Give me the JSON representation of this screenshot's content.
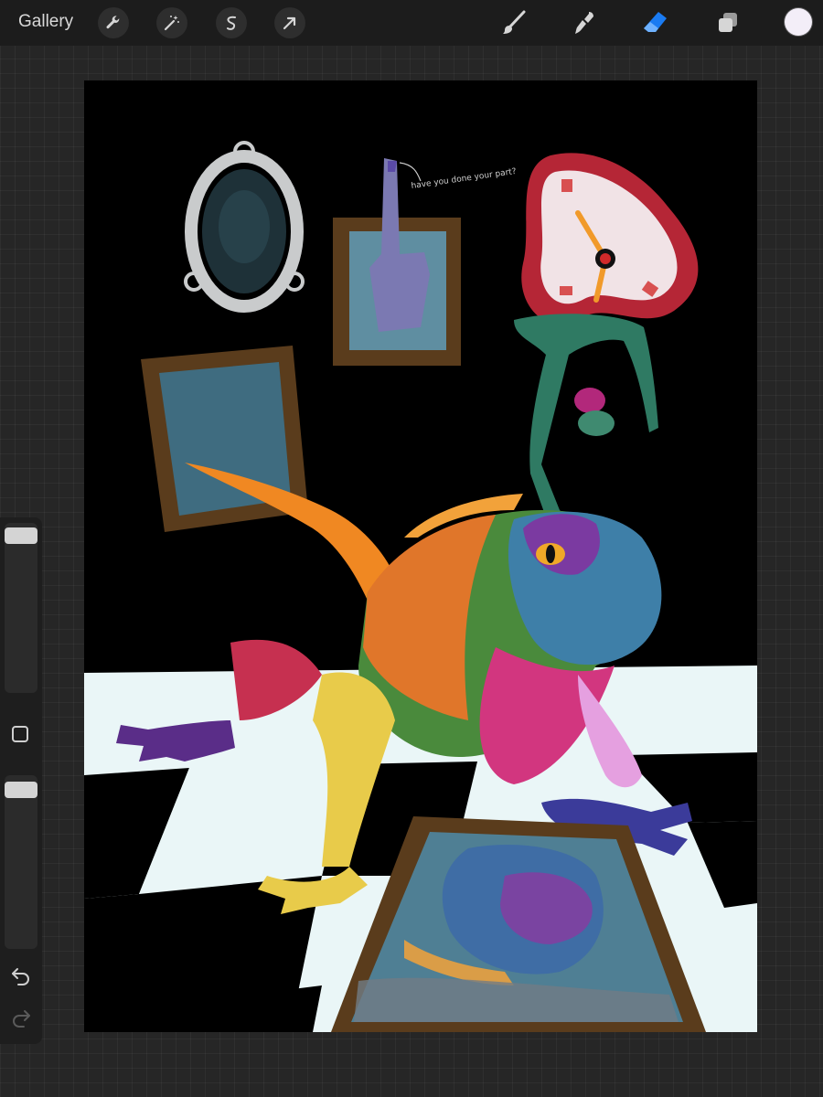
{
  "topbar": {
    "gallery_label": "Gallery",
    "actions": [
      {
        "name": "wrench-icon"
      },
      {
        "name": "magic-wand-icon"
      },
      {
        "name": "selection-icon"
      },
      {
        "name": "transform-arrow-icon"
      }
    ],
    "tools": [
      {
        "name": "brush-icon"
      },
      {
        "name": "smudge-icon"
      },
      {
        "name": "eraser-icon",
        "active": true
      },
      {
        "name": "layers-icon"
      }
    ],
    "active_color": "#f3eef8",
    "accent_color": "#1a7bf2"
  },
  "sidebar": {
    "brush_size_level": 0.97,
    "opacity_level": 0.96,
    "undo_icon": "undo-icon",
    "redo_icon": "redo-icon"
  },
  "artwork": {
    "wall_note": "have you done your part?"
  }
}
